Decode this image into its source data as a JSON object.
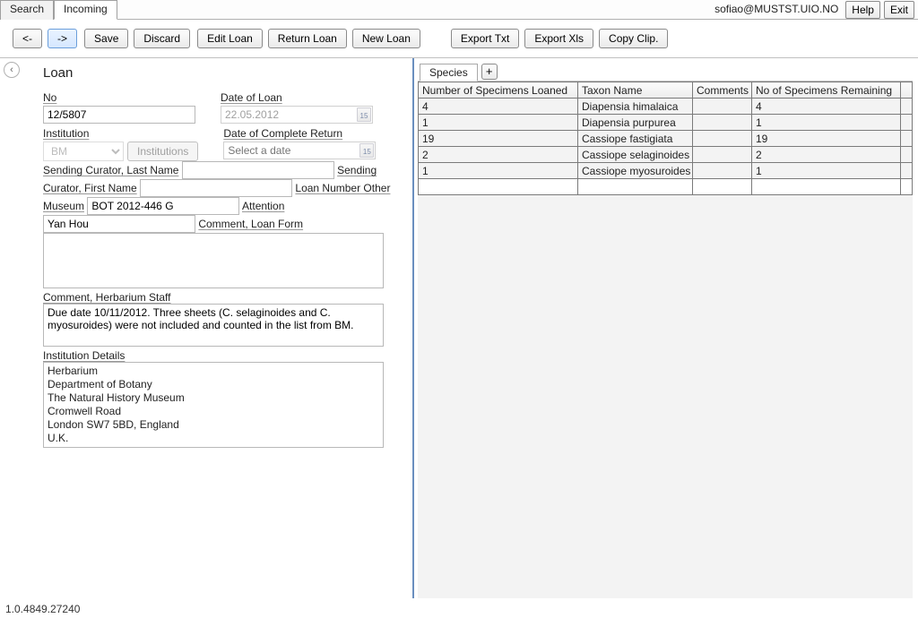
{
  "top": {
    "tabs": [
      "Search",
      "Incoming"
    ],
    "active_tab": 1,
    "user": "sofiao@MUSTST.UIO.NO",
    "help": "Help",
    "exit": "Exit"
  },
  "toolbar": {
    "prev": "<-",
    "next": "->",
    "save": "Save",
    "discard": "Discard",
    "editLoan": "Edit Loan",
    "returnLoan": "Return Loan",
    "newLoan": "New Loan",
    "exportTxt": "Export Txt",
    "exportXls": "Export Xls",
    "copyClip": "Copy Clip."
  },
  "loan": {
    "heading": "Loan",
    "labels": {
      "no": "No",
      "dateOfLoan": "Date of Loan",
      "institution": "Institution",
      "dateOfCompleteReturn": "Date of Complete Return",
      "institutionsBtn": "Institutions",
      "sendingLast": "Sending Curator, Last Name",
      "sendingFirst": "Sending Curator, First Name",
      "loanNoOther": "Loan Number Other Museum",
      "attention": "Attention",
      "commentLoan": "Comment, Loan Form",
      "commentStaff": "Comment, Herbarium Staff",
      "instDetails": "Institution Details"
    },
    "values": {
      "no": "12/5807",
      "dateOfLoan": "22.05.2012",
      "dateReturnPlaceholder": "Select a date",
      "institution": "BM",
      "sendingLast": "",
      "sendingFirst": "",
      "loanNoOther": "BOT 2012-446 G",
      "attention": "Yan Hou",
      "commentLoan": "",
      "commentStaff": "Due date 10/11/2012. Three sheets (C. selaginoides and C. myosuroides) were not included and counted in the list from BM.",
      "instDetails": "Herbarium\nDepartment of Botany\nThe Natural History Museum\nCromwell Road\nLondon SW7 5BD, England\nU.K."
    }
  },
  "species": {
    "tabLabel": "Species",
    "addLabel": "+",
    "headers": [
      "Number of Specimens Loaned",
      "Taxon Name",
      "Comments",
      "No of Specimens Remaining",
      ""
    ],
    "rows": [
      {
        "loaned": "4",
        "taxon": "Diapensia himalaica",
        "comments": "",
        "remain": "4"
      },
      {
        "loaned": "1",
        "taxon": "Diapensia purpurea",
        "comments": "",
        "remain": "1"
      },
      {
        "loaned": "19",
        "taxon": "Cassiope fastigiata",
        "comments": "",
        "remain": "19"
      },
      {
        "loaned": "2",
        "taxon": "Cassiope selaginoides",
        "comments": "",
        "remain": "2"
      },
      {
        "loaned": "1",
        "taxon": "Cassiope myosuroides",
        "comments": "",
        "remain": "1"
      }
    ]
  },
  "status": {
    "version": "1.0.4849.27240"
  }
}
